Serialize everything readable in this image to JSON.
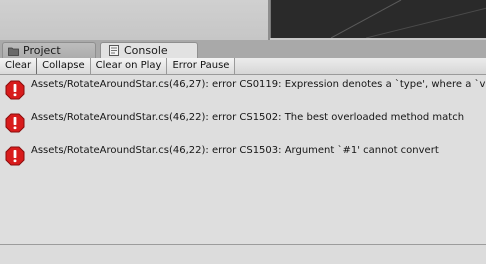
{
  "tabs": [
    {
      "label": "Project",
      "icon": "folder-icon"
    },
    {
      "label": "Console",
      "icon": "console-icon"
    }
  ],
  "toolbar": {
    "clear_label": "Clear",
    "collapse_label": "Collapse",
    "clear_on_play_label": "Clear on Play",
    "error_pause_label": "Error Pause"
  },
  "log": {
    "entries": [
      {
        "type": "error",
        "icon": "error-icon",
        "text": "Assets/RotateAroundStar.cs(46,27): error CS0119: Expression denotes a `type', where a `variable', `value' or `method group' was expected"
      },
      {
        "type": "error",
        "icon": "error-icon",
        "text": "Assets/RotateAroundStar.cs(46,22): error CS1502: The best overloaded method match"
      },
      {
        "type": "error",
        "icon": "error-icon",
        "text": "Assets/RotateAroundStar.cs(46,22): error CS1503: Argument `#1' cannot convert"
      }
    ]
  },
  "colors": {
    "error_red": "#d81c1c",
    "scene_bg": "#2a2a2a",
    "panel_bg": "#dedede"
  }
}
